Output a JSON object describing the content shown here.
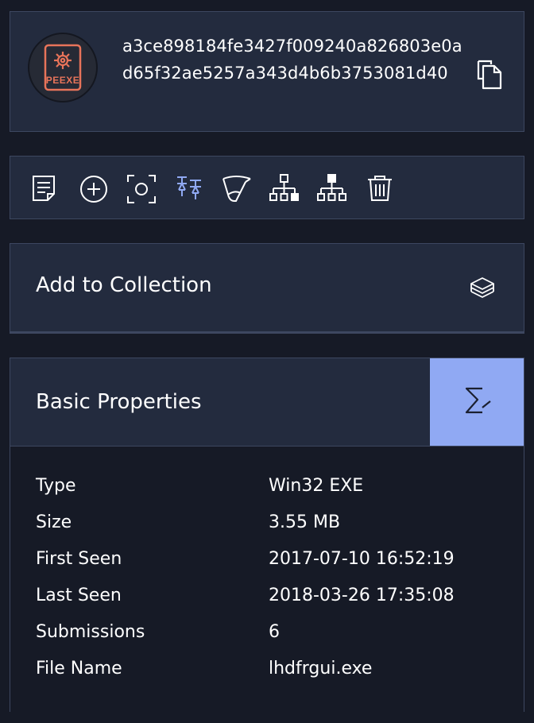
{
  "file": {
    "type_badge": "PEEXE",
    "hash": "a3ce898184fe3427f009240a826803e0ad65f32ae5257a343d4b6b3753081d40",
    "copy_icon": "copy-icon"
  },
  "toolbar": {
    "icons": [
      "report-icon",
      "add-icon",
      "screenshot-icon",
      "pin-icon",
      "funnel-icon",
      "graph-outline-icon",
      "graph-filled-icon",
      "trash-icon"
    ],
    "active_color": "#90a9f3"
  },
  "collection": {
    "label": "Add to Collection",
    "icon": "stack-icon"
  },
  "basic_properties": {
    "title": "Basic Properties",
    "summary_icon": "sigma-icon",
    "rows": [
      {
        "key": "Type",
        "value": "Win32 EXE"
      },
      {
        "key": "Size",
        "value": "3.55 MB"
      },
      {
        "key": "First Seen",
        "value": "2017-07-10 16:52:19"
      },
      {
        "key": "Last Seen",
        "value": "2018-03-26 17:35:08"
      },
      {
        "key": "Submissions",
        "value": "6"
      },
      {
        "key": "File Name",
        "value": "lhdfrgui.exe"
      }
    ]
  },
  "colors": {
    "background": "#161a26",
    "panel": "#232b3e",
    "accent": "#90a9f3",
    "badge": "#e8745a"
  }
}
